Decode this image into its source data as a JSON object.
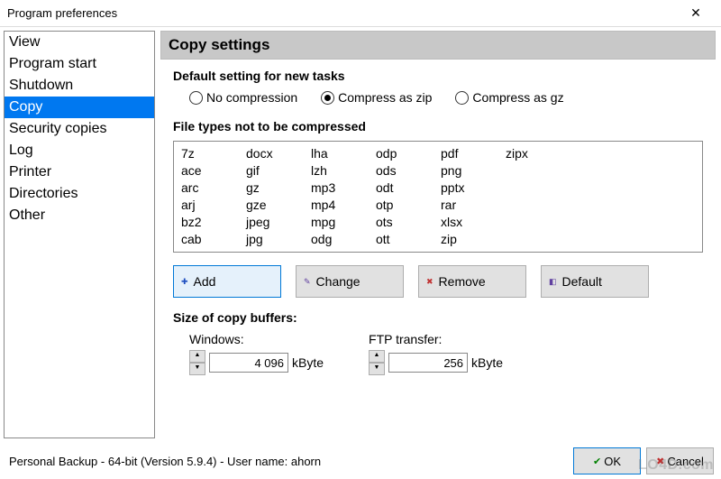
{
  "window": {
    "title": "Program preferences"
  },
  "sidebar": {
    "items": [
      {
        "label": "View"
      },
      {
        "label": "Program start"
      },
      {
        "label": "Shutdown"
      },
      {
        "label": "Copy",
        "selected": true
      },
      {
        "label": "Security copies"
      },
      {
        "label": "Log"
      },
      {
        "label": "Printer"
      },
      {
        "label": "Directories"
      },
      {
        "label": "Other"
      }
    ]
  },
  "main": {
    "header": "Copy settings",
    "default_setting_label": "Default setting for new tasks",
    "radios": {
      "none": "No compression",
      "zip": "Compress as zip",
      "gz": "Compress as gz",
      "selected": "zip"
    },
    "ext_label": "File types not to be compressed",
    "extensions": [
      "7z",
      "docx",
      "lha",
      "odp",
      "pdf",
      "zipx",
      "ace",
      "gif",
      "lzh",
      "ods",
      "png",
      "",
      "arc",
      "gz",
      "mp3",
      "odt",
      "pptx",
      "",
      "arj",
      "gze",
      "mp4",
      "otp",
      "rar",
      "",
      "bz2",
      "jpeg",
      "mpg",
      "ots",
      "xlsx",
      "",
      "cab",
      "jpg",
      "odg",
      "ott",
      "zip",
      ""
    ],
    "buttons": {
      "add": "Add",
      "change": "Change",
      "remove": "Remove",
      "default": "Default"
    },
    "buffers": {
      "label": "Size of copy buffers:",
      "windows_label": "Windows:",
      "windows_value": "4 096",
      "ftp_label": "FTP transfer:",
      "ftp_value": "256",
      "unit": "kByte"
    }
  },
  "footer": {
    "status": "Personal Backup - 64-bit (Version 5.9.4) - User name: ahorn",
    "ok": "OK",
    "cancel": "Cancel"
  },
  "watermark": "LO4D.com"
}
